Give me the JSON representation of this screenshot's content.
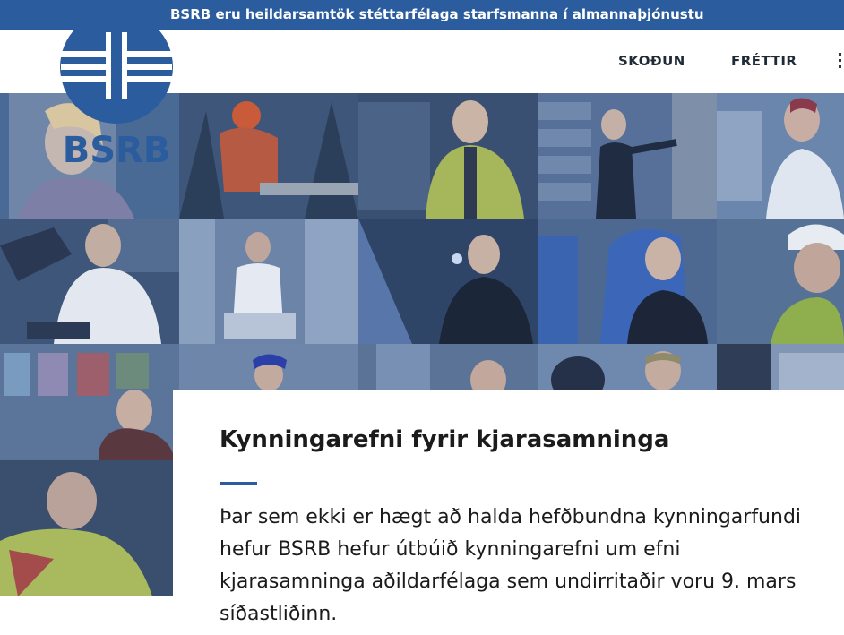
{
  "topbar": {
    "tagline": "BSRB eru heildarsamtök stéttarfélaga starfsmanna í almannaþjónustu"
  },
  "logo": {
    "text": "BSRB",
    "icon": "bsrb-logo-icon"
  },
  "nav": {
    "items": [
      {
        "label": "SKOÐUN"
      },
      {
        "label": "FRÉTTIR"
      }
    ],
    "more_icon": "more-menu-icon"
  },
  "hero": {
    "tiles": [
      {
        "subject": "woman-portrait"
      },
      {
        "subject": "chainsaw-worker"
      },
      {
        "subject": "man-in-hi-vis-jacket"
      },
      {
        "subject": "woman-at-shelves"
      },
      {
        "subject": "nurse-smiling"
      },
      {
        "subject": "man-at-desk"
      },
      {
        "subject": "woman-in-corridor"
      },
      {
        "subject": "police-officer"
      },
      {
        "subject": "bus-driver"
      },
      {
        "subject": "worker-with-helmet"
      },
      {
        "subject": "women-in-office"
      },
      {
        "subject": "driver-in-vehicle"
      }
    ]
  },
  "article": {
    "title": "Kynningarefni fyrir kjarasamninga",
    "body": "Þar sem ekki er hægt að halda hefðbundna kynningarfundi hefur BSRB hefur útbúið kynningarefni um efni kjarasamninga aðildarfélaga sem undirritaðir voru 9. mars síðastliðinn."
  },
  "colors": {
    "brand": "#2b5d9e",
    "overlay": "#31517e"
  }
}
